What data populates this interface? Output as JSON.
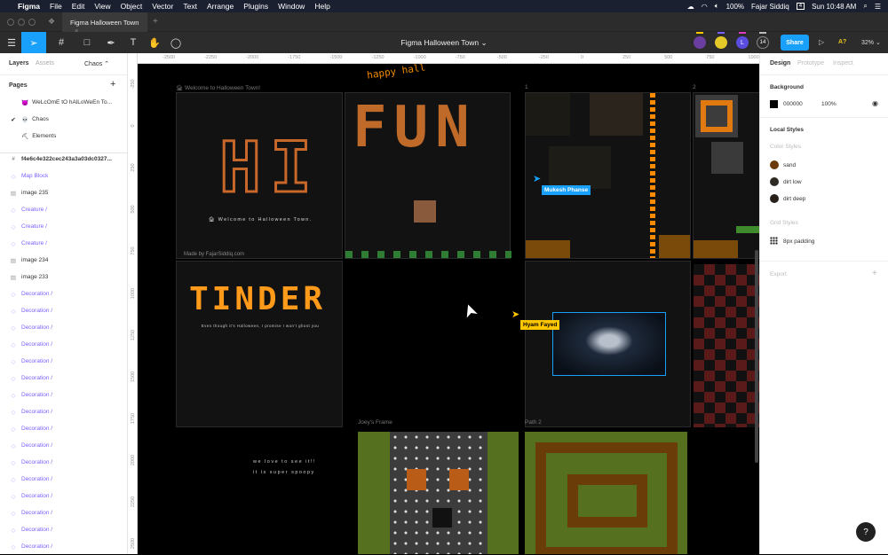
{
  "menubar": {
    "app": "Figma",
    "items": [
      "File",
      "Edit",
      "View",
      "Object",
      "Vector",
      "Text",
      "Arrange",
      "Plugins",
      "Window",
      "Help"
    ],
    "battery": "100%",
    "user": "Fajar Siddiq",
    "date_badge": "4",
    "clock": "Sun 10:48 AM"
  },
  "tab": {
    "title": "Figma Halloween Town",
    "new": "+",
    "close": "×"
  },
  "toolbar": {
    "file_title": "Figma Halloween Town ⌄",
    "avatar_letter": "L",
    "avatar_count": "14",
    "share": "Share",
    "a_label": "A?",
    "zoom": "32% ⌄"
  },
  "left": {
    "tabs": [
      "Layers",
      "Assets"
    ],
    "page_select": "Chaos ⌃",
    "pages_header": "Pages",
    "add": "+",
    "pages": [
      {
        "label": "WeLcOmE tO hAlLoWeEn To...",
        "icon": "😈"
      },
      {
        "label": "Chaos",
        "icon": "💀",
        "current": true
      },
      {
        "label": "Elements",
        "icon": "⛏"
      }
    ],
    "layers": [
      {
        "label": "f4e6c4e322cec243a3a03dc0327...",
        "type": "frame"
      },
      {
        "label": "Map Block",
        "type": "component"
      },
      {
        "label": "image 235",
        "type": "image"
      },
      {
        "label": "Creature /",
        "type": "component"
      },
      {
        "label": "Creature /",
        "type": "component"
      },
      {
        "label": "Creature /",
        "type": "component"
      },
      {
        "label": "image 234",
        "type": "image"
      },
      {
        "label": "image 233",
        "type": "image"
      },
      {
        "label": "Decoration /",
        "type": "component"
      },
      {
        "label": "Decoration /",
        "type": "component"
      },
      {
        "label": "Decoration /",
        "type": "component"
      },
      {
        "label": "Decoration /",
        "type": "component"
      },
      {
        "label": "Decoration /",
        "type": "component"
      },
      {
        "label": "Decoration /",
        "type": "component"
      },
      {
        "label": "Decoration /",
        "type": "component"
      },
      {
        "label": "Decoration /",
        "type": "component"
      },
      {
        "label": "Decoration /",
        "type": "component"
      },
      {
        "label": "Decoration /",
        "type": "component"
      },
      {
        "label": "Decoration /",
        "type": "component"
      },
      {
        "label": "Decoration /",
        "type": "component"
      },
      {
        "label": "Decoration /",
        "type": "component"
      },
      {
        "label": "Decoration /",
        "type": "component"
      },
      {
        "label": "Decoration /",
        "type": "component"
      },
      {
        "label": "Decoration /",
        "type": "component"
      }
    ]
  },
  "rulers": {
    "h": [
      "-2500",
      "-2250",
      "-2000",
      "-1750",
      "-1500",
      "-1250",
      "-1000",
      "-750",
      "-500",
      "-250",
      "0",
      "250",
      "500",
      "750",
      "1000"
    ],
    "v": [
      "-250",
      "0",
      "250",
      "500",
      "750",
      "1000",
      "1250",
      "1500",
      "1750",
      "2000",
      "2250",
      "2500"
    ]
  },
  "canvas": {
    "happy": "happy hall",
    "frame_welcome": "🏚 Welcome to Halloween Town!",
    "hi": "HI",
    "welcome_text": "🏚 Welcome to Halloween Town.",
    "made_by": "Made by FajarSiddiq.com",
    "fun": "FUN",
    "frame_1": "1",
    "frame_2": "2",
    "tinder": "TINDER",
    "tinder_caption": "Even though it's Halloween, I promise I won't ghost you",
    "love1": "we love to see it!!",
    "love2": "it is super spoopy",
    "joey": "Joey's Frame",
    "path2": "Path 2",
    "cursor1": "Mukesh Phanse",
    "cursor2": "Hyam Fayed"
  },
  "right": {
    "tabs": [
      "Design",
      "Prototype",
      "Inspect"
    ],
    "background": "Background",
    "bg_hex": "000000",
    "bg_opacity": "100%",
    "local_styles": "Local Styles",
    "color_styles": "Color Styles",
    "colors": [
      {
        "name": "sand",
        "hex": "#6b3a0a"
      },
      {
        "name": "dirt low",
        "hex": "#2e2a24"
      },
      {
        "name": "dirt deep",
        "hex": "#27211a"
      }
    ],
    "grid_styles": "Grid Styles",
    "grid": "8px padding",
    "export": "Export",
    "add": "+"
  },
  "help": "?",
  "colors": {
    "accent": "#18a0fb",
    "component": "#7b61ff",
    "cursor1": "#18a0fb",
    "cursor2": "#ffc700"
  }
}
